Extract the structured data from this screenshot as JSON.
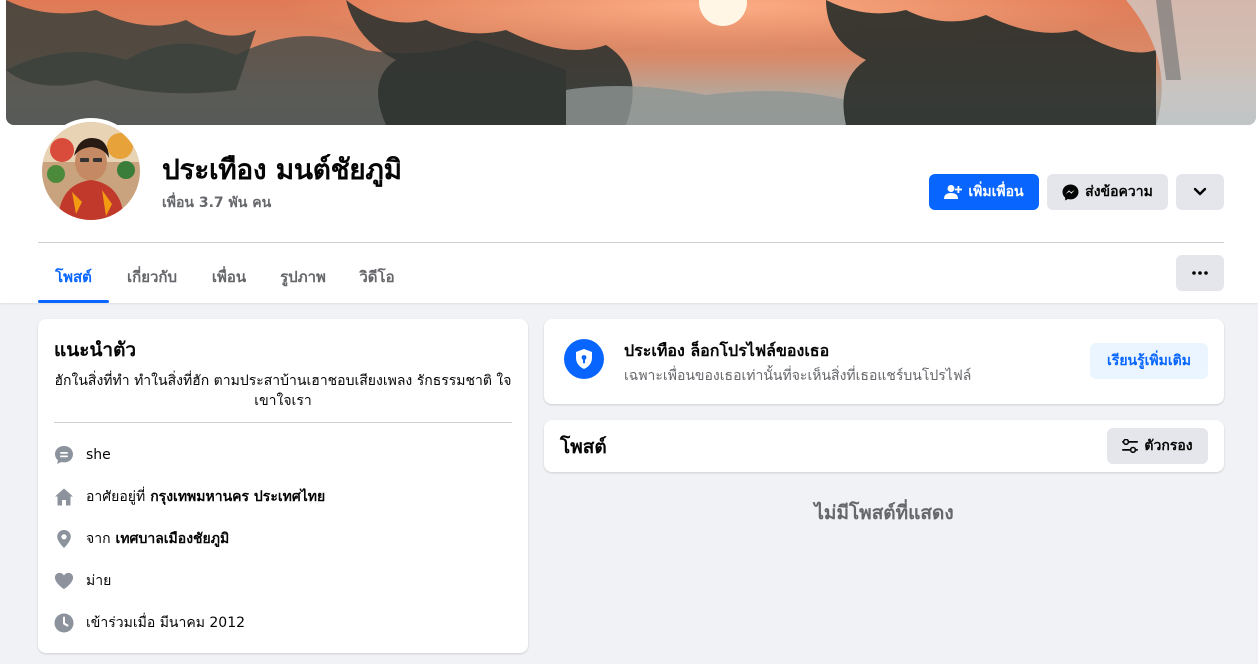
{
  "profile": {
    "name": "ประเทือง มนต์ชัยภูมิ",
    "friend_count": "เพื่อน 3.7 พัน คน"
  },
  "actions": {
    "add_friend": "เพิ่มเพื่อน",
    "message": "ส่งข้อความ"
  },
  "tabs": [
    {
      "label": "โพสต์",
      "active": true
    },
    {
      "label": "เกี่ยวกับ",
      "active": false
    },
    {
      "label": "เพื่อน",
      "active": false
    },
    {
      "label": "รูปภาพ",
      "active": false
    },
    {
      "label": "วิดีโอ",
      "active": false
    }
  ],
  "intro": {
    "title": "แนะนำตัว",
    "bio": "ฮักในสิ่งที่ทำ ทำในสิ่งที่ฮัก ตามประสาบ้านเฮาชอบเสียงเพลง รักธรรมชาติ ใจเขาใจเรา",
    "pronoun": "she",
    "lives_prefix": "อาศัยอยู่ที่",
    "lives_value": "กรุงเทพมหานคร ประเทศไทย",
    "from_prefix": "จาก",
    "from_value": "เทศบาลเมืองชัยภูมิ",
    "relationship": "ม่าย",
    "joined": "เข้าร่วมเมื่อ มีนาคม 2012"
  },
  "lock_notice": {
    "title": "ประเทือง ล็อกโปรไฟล์ของเธอ",
    "subtitle": "เฉพาะเพื่อนของเธอเท่านั้นที่จะเห็นสิ่งที่เธอแชร์บนโปรไฟล์",
    "learn_more": "เรียนรู้เพิ่มเติม"
  },
  "posts": {
    "title": "โพสต์",
    "filter_label": "ตัวกรอง",
    "empty_message": "ไม่มีโพสต์ที่แสดง"
  },
  "colors": {
    "accent": "#0866ff",
    "background": "#f0f2f5",
    "secondary_text": "#65676b"
  }
}
